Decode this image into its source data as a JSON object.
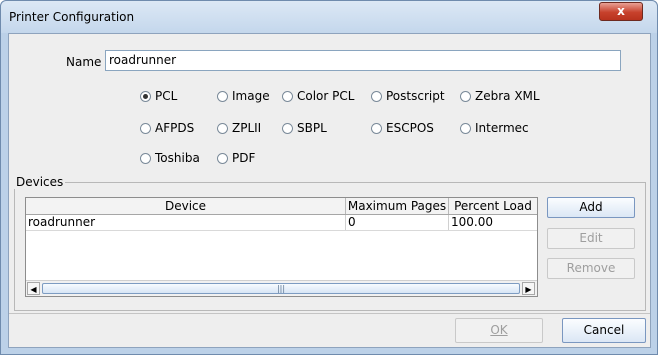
{
  "window": {
    "title": "Printer Configuration",
    "close_label": "x"
  },
  "name": {
    "label": "Name",
    "value": "roadrunner"
  },
  "printer_types": [
    {
      "label": "PCL",
      "checked": true
    },
    {
      "label": "Image",
      "checked": false
    },
    {
      "label": "Color PCL",
      "checked": false
    },
    {
      "label": "Postscript",
      "checked": false
    },
    {
      "label": "Zebra XML",
      "checked": false
    },
    {
      "label": "AFPDS",
      "checked": false
    },
    {
      "label": "ZPLII",
      "checked": false
    },
    {
      "label": "SBPL",
      "checked": false
    },
    {
      "label": "ESCPOS",
      "checked": false
    },
    {
      "label": "Intermec",
      "checked": false
    },
    {
      "label": "Toshiba",
      "checked": false
    },
    {
      "label": "PDF",
      "checked": false
    }
  ],
  "devices": {
    "legend": "Devices",
    "columns": [
      "Device",
      "Maximum Pages",
      "Percent Load"
    ],
    "rows": [
      [
        "roadrunner",
        "0",
        "100.00"
      ]
    ],
    "scroll_left": "◀",
    "scroll_right": "▶",
    "thumb_grip": "|||"
  },
  "buttons": {
    "add": "Add",
    "edit": "Edit",
    "remove": "Remove",
    "ok": "OK",
    "cancel": "Cancel"
  }
}
